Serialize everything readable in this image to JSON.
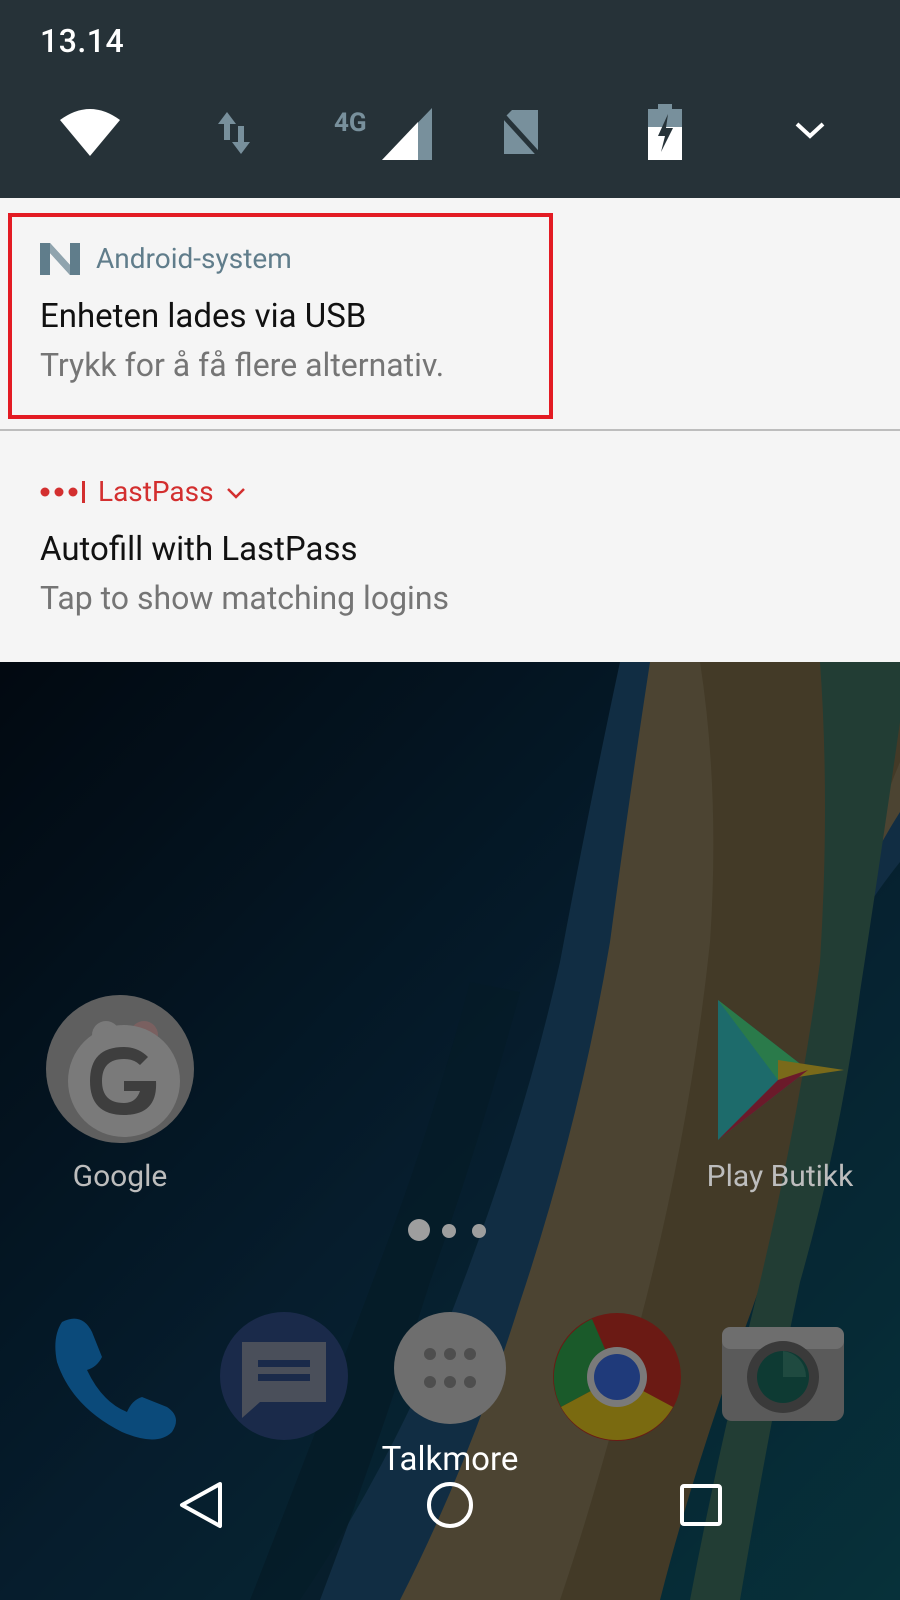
{
  "status": {
    "time": "13.14",
    "network_label": "4G",
    "icons": [
      "wifi-icon",
      "data-arrows-icon",
      "cell-signal-icon",
      "no-sim-icon",
      "battery-charging-icon",
      "expand-chevron-icon"
    ]
  },
  "notifications": [
    {
      "app": "Android-system",
      "app_icon": "android-n-icon",
      "app_color": "#607d8b",
      "title": "Enheten lades via USB",
      "text": "Trykk for å få flere alternativ."
    },
    {
      "app": "LastPass",
      "app_icon": "lastpass-dots-icon",
      "app_color": "#d32f2f",
      "title": "Autofill with LastPass",
      "text": "Tap to show matching logins"
    }
  ],
  "home": {
    "apps": [
      {
        "label": "Google",
        "icon": "google-folder-icon"
      },
      {
        "label": "Play Butikk",
        "icon": "play-store-icon"
      }
    ],
    "page_count": 3,
    "dock": [
      {
        "icon": "phone-icon"
      },
      {
        "icon": "messages-icon"
      },
      {
        "icon": "app-drawer-icon",
        "label": "Talkmore"
      },
      {
        "icon": "chrome-icon"
      },
      {
        "icon": "camera-icon"
      }
    ]
  },
  "navbar": {
    "icons": [
      "back-icon",
      "home-icon",
      "recents-icon"
    ]
  },
  "colors": {
    "header_bg": "#263238",
    "notification_bg": "#f5f5f5",
    "highlight": "#e31b23"
  }
}
